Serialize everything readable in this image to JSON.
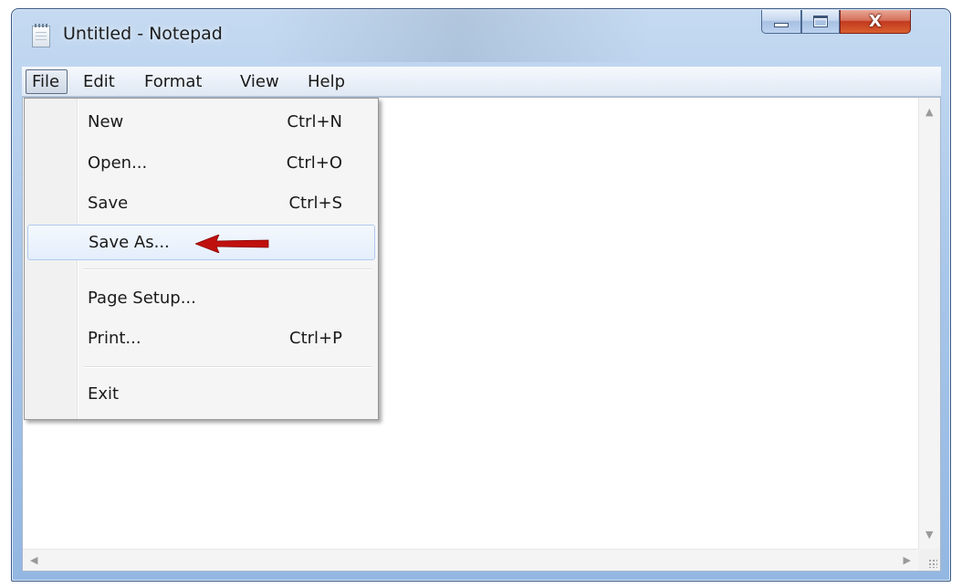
{
  "window": {
    "title": "Untitled - Notepad",
    "icons": {
      "app": "notepad-icon",
      "minimize": "minimize-icon",
      "maximize": "maximize-icon",
      "close": "close-icon"
    },
    "close_glyph": "X"
  },
  "menubar": {
    "items": [
      {
        "label": "File",
        "active": true
      },
      {
        "label": "Edit"
      },
      {
        "label": "Format"
      },
      {
        "label": "View"
      },
      {
        "label": "Help"
      }
    ]
  },
  "file_menu": {
    "items": [
      {
        "label": "New",
        "shortcut": "Ctrl+N"
      },
      {
        "label": "Open...",
        "shortcut": "Ctrl+O"
      },
      {
        "label": "Save",
        "shortcut": "Ctrl+S"
      },
      {
        "label": "Save As...",
        "shortcut": "",
        "highlighted": true
      },
      {
        "label": "Page Setup...",
        "shortcut": ""
      },
      {
        "label": "Print...",
        "shortcut": "Ctrl+P"
      },
      {
        "label": "Exit",
        "shortcut": ""
      }
    ],
    "annotation_icon": "red-arrow-icon"
  },
  "editor": {
    "content": "",
    "scroll_icons": [
      "scroll-up-icon",
      "scroll-down-icon",
      "scroll-left-icon",
      "scroll-right-icon",
      "resize-grip-icon"
    ]
  },
  "colors": {
    "title_bar": "#a9c7ea",
    "close_button": "#c2391f",
    "menu_highlight_border": "#aecaf0",
    "annotation_arrow": "#c0100e"
  }
}
